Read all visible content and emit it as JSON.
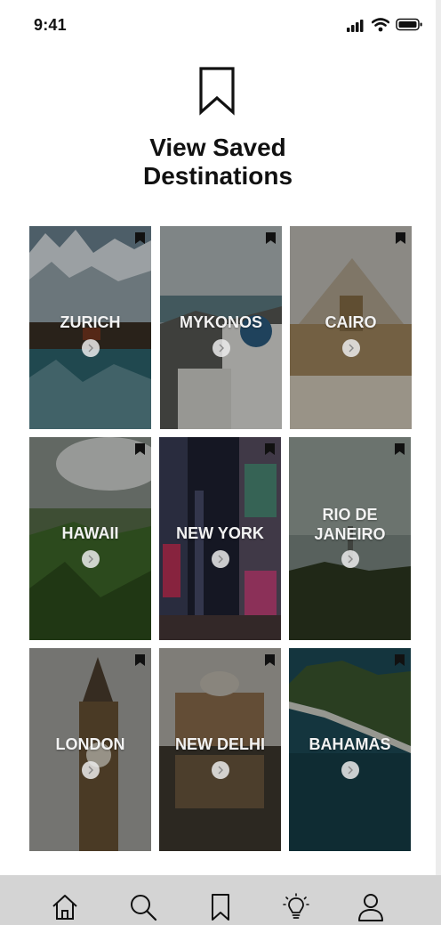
{
  "status_bar": {
    "time": "9:41",
    "icons": [
      "signal-icon",
      "wifi-icon",
      "battery-icon"
    ]
  },
  "header": {
    "icon": "bookmark-icon",
    "title": "View Saved\nDestinations"
  },
  "destinations": [
    {
      "label": "ZURICH",
      "saved": true
    },
    {
      "label": "MYKONOS",
      "saved": true
    },
    {
      "label": "CAIRO",
      "saved": true
    },
    {
      "label": "HAWAII",
      "saved": true
    },
    {
      "label": "NEW YORK",
      "saved": true
    },
    {
      "label": "RIO DE\nJANEIRO",
      "saved": true
    },
    {
      "label": "LONDON",
      "saved": true
    },
    {
      "label": "NEW DELHI",
      "saved": true
    },
    {
      "label": "BAHAMAS",
      "saved": true
    }
  ],
  "bottom_nav": {
    "items": [
      {
        "icon": "home-icon"
      },
      {
        "icon": "search-icon"
      },
      {
        "icon": "bookmark-icon"
      },
      {
        "icon": "lightbulb-icon"
      },
      {
        "icon": "profile-icon"
      }
    ]
  },
  "colors": {
    "background": "#ffffff",
    "nav_background": "#d4d4d4",
    "card_label": "#f2f2f2"
  }
}
